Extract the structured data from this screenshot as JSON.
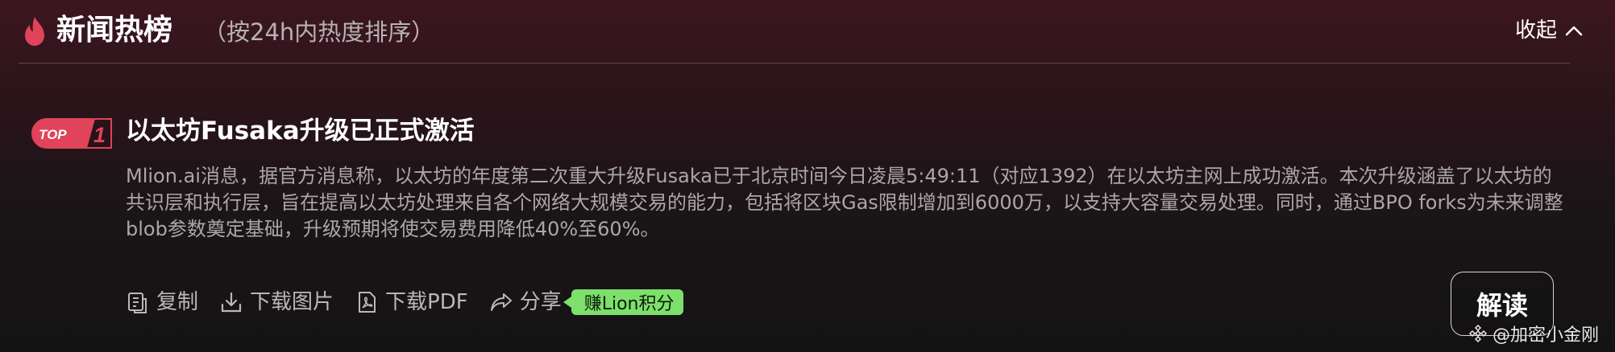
{
  "header": {
    "title": "新闻热榜",
    "subtitle": "（按24h内热度排序）",
    "collapse_label": "收起"
  },
  "news": {
    "rank_badge_text": "TOP",
    "rank_number": "1",
    "title": "以太坊Fusaka升级已正式激活",
    "body": "Mlion.ai消息，据官方消息称，以太坊的年度第二次重大升级Fusaka已于北京时间今日凌晨5:49:11（对应1392）在以太坊主网上成功激活。本次升级涵盖了以太坊的共识层和执行层，旨在提高以太坊处理来自各个网络大规模交易的能力，包括将区块Gas限制增加到6000万，以支持大容量交易处理。同时，通过BPO forks为未来调整blob参数奠定基础，升级预期将使交易费用降低40%至60%。"
  },
  "actions": {
    "copy": "复制",
    "download_image": "下载图片",
    "download_pdf": "下载PDF",
    "share": "分享",
    "earn_points": "赚Lion积分"
  },
  "interpret_label": "解读",
  "watermark": "@加密小金刚",
  "icons": {
    "flame": "flame-icon",
    "collapse": "chevron-up-icon",
    "copy": "copy-icon",
    "download_image": "download-icon",
    "download_pdf": "pdf-icon",
    "share": "share-icon",
    "watermark": "binance-logo-icon"
  },
  "colors": {
    "accent_red": "#e0435a",
    "earn_green": "#7ce06b",
    "background_top": "#3c1620",
    "background_bottom": "#141313"
  }
}
